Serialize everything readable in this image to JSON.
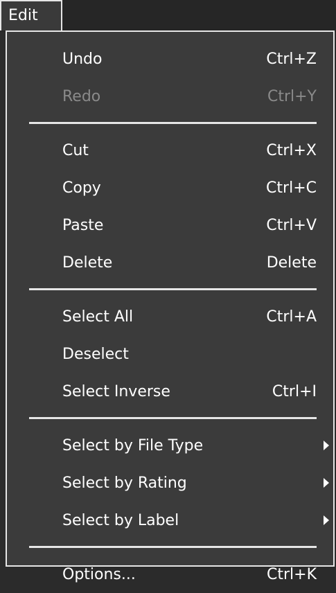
{
  "menubar": {
    "title": "Edit"
  },
  "menu": {
    "undo": {
      "label": "Undo",
      "shortcut": "Ctrl+Z"
    },
    "redo": {
      "label": "Redo",
      "shortcut": "Ctrl+Y",
      "enabled": false
    },
    "cut": {
      "label": "Cut",
      "shortcut": "Ctrl+X"
    },
    "copy": {
      "label": "Copy",
      "shortcut": "Ctrl+C"
    },
    "paste": {
      "label": "Paste",
      "shortcut": "Ctrl+V"
    },
    "delete": {
      "label": "Delete",
      "shortcut": "Delete"
    },
    "select_all": {
      "label": "Select All",
      "shortcut": "Ctrl+A"
    },
    "deselect": {
      "label": "Deselect"
    },
    "select_inverse": {
      "label": "Select Inverse",
      "shortcut": "Ctrl+I"
    },
    "select_by_file_type": {
      "label": "Select by File Type",
      "submenu": true
    },
    "select_by_rating": {
      "label": "Select by Rating",
      "submenu": true
    },
    "select_by_label": {
      "label": "Select by Label",
      "submenu": true
    },
    "options": {
      "label": "Options...",
      "shortcut": "Ctrl+K"
    }
  }
}
